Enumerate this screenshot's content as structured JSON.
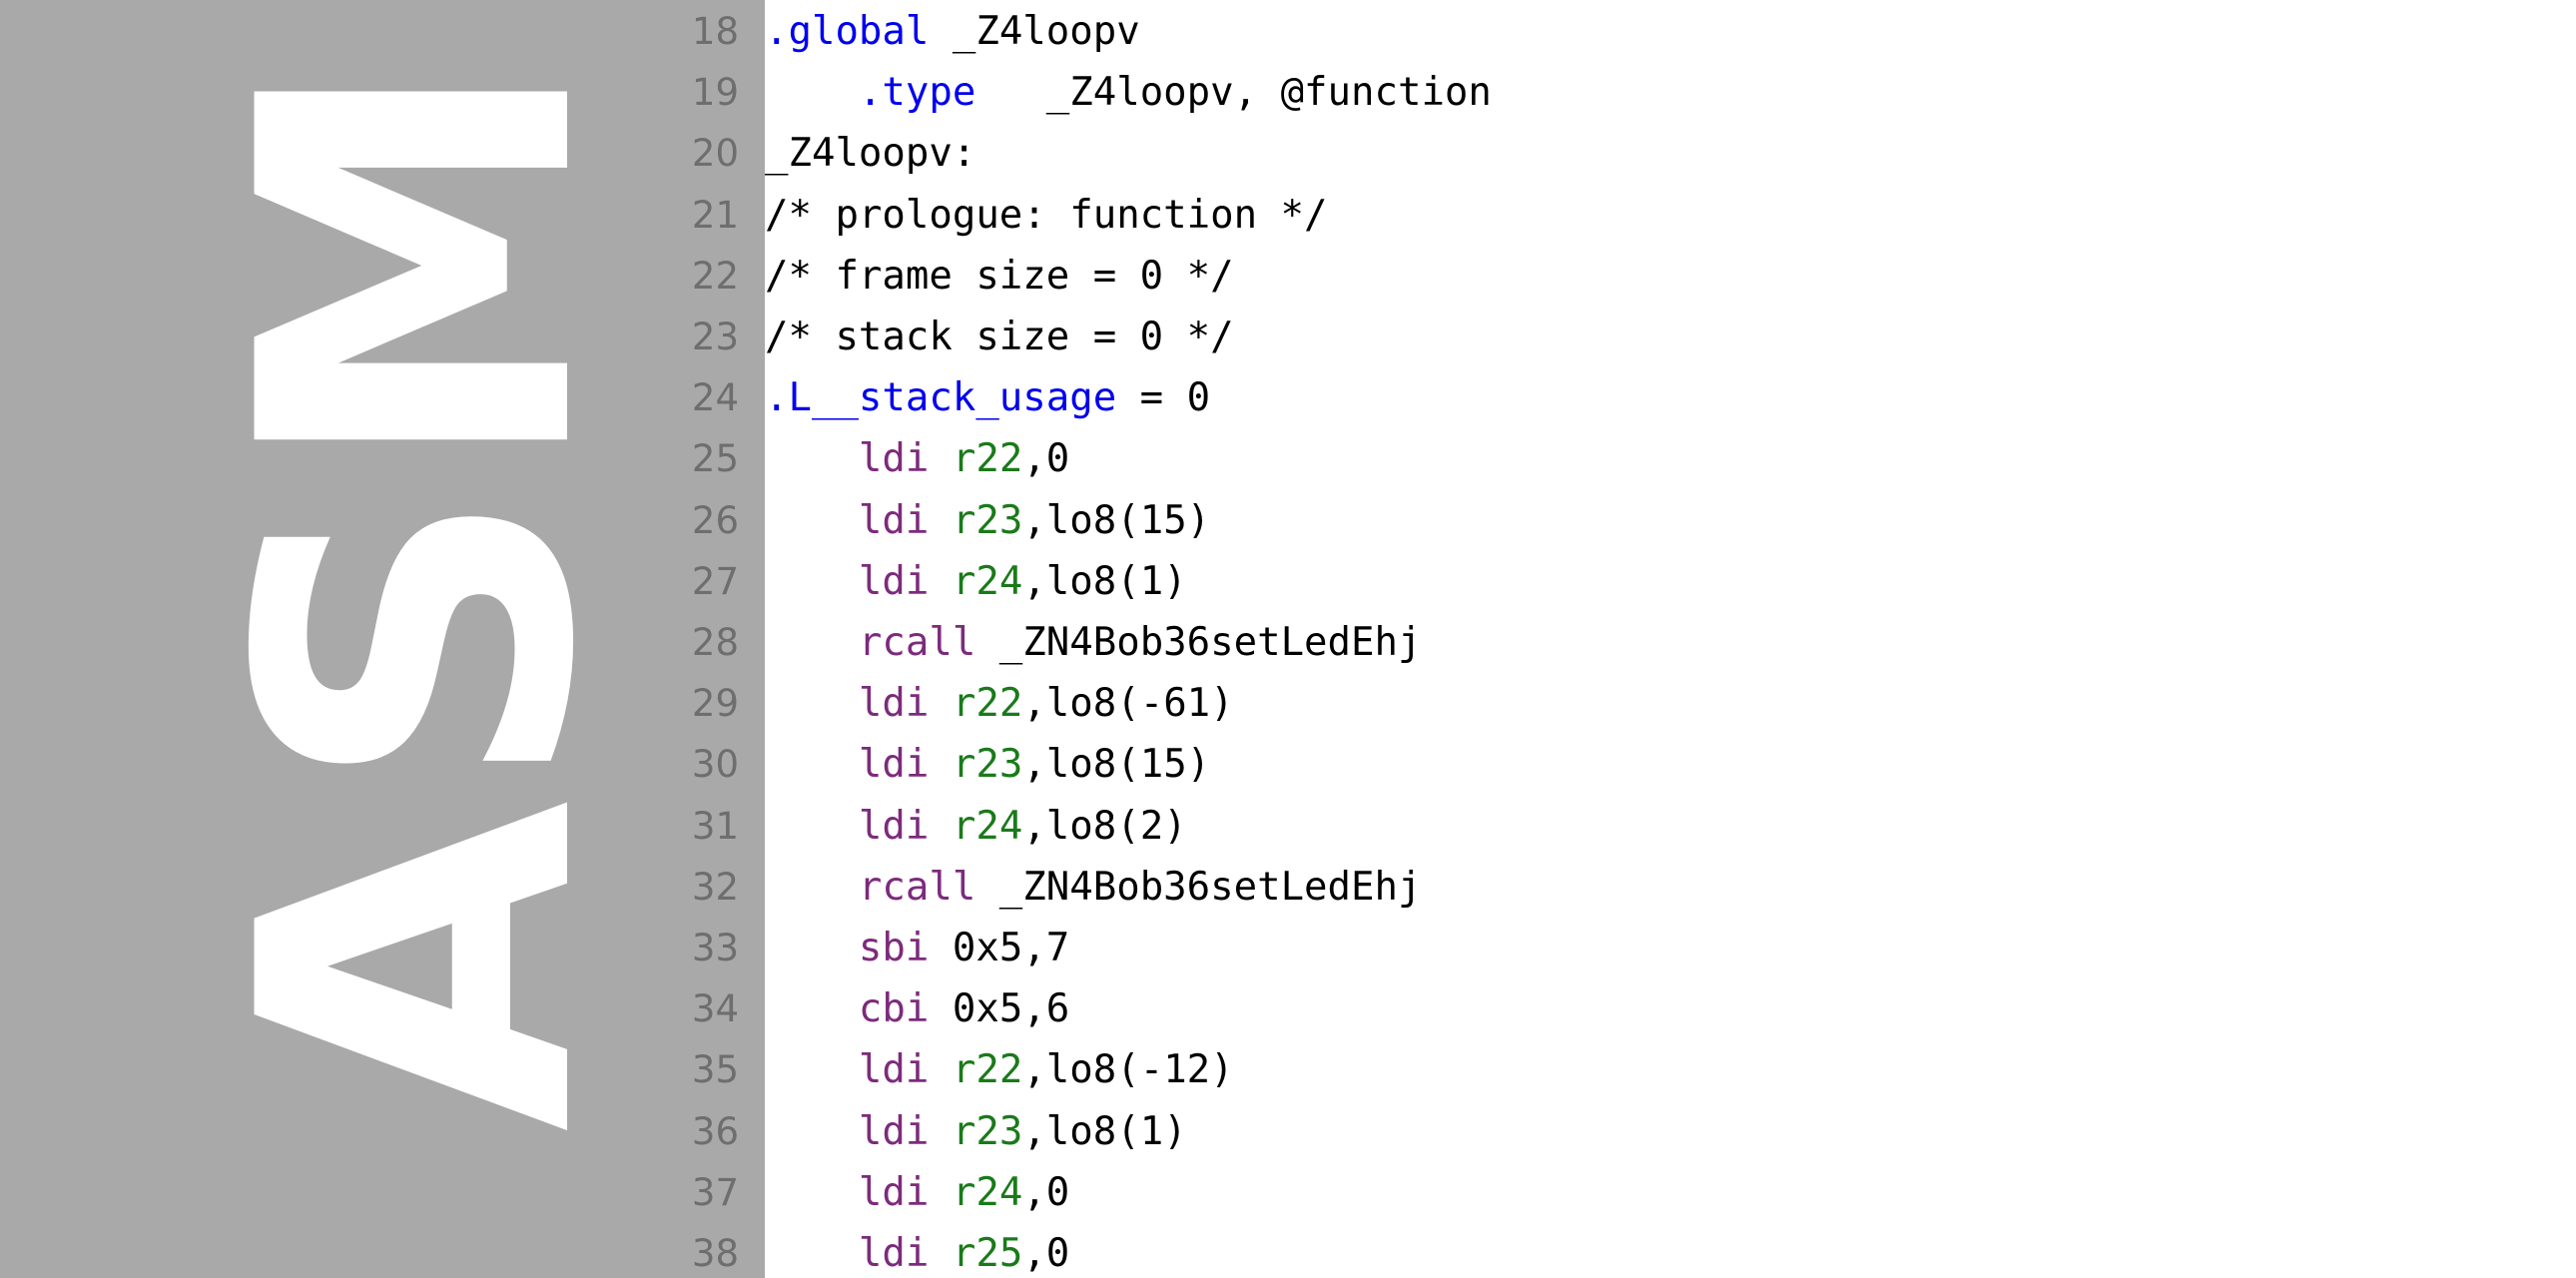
{
  "document": {
    "kind": "assembly-listing",
    "language_label": "ASM",
    "watermark_text": "ASM",
    "first_visible_line": 18,
    "last_visible_line": 38
  },
  "colors": {
    "page_background": "#ffffff",
    "gutter_background": "#a9a9a9",
    "watermark_text": "#ffffff",
    "line_number": "#6e6e6e",
    "directive": "#0000ee",
    "mnemonic": "#7d2a7d",
    "register": "#1a7a1a",
    "plain": "#000000"
  },
  "lines": [
    {
      "number": "18",
      "tokens": [
        {
          "text": ".global",
          "type": "directive"
        },
        {
          "text": " _Z4loopv",
          "type": "plain"
        }
      ]
    },
    {
      "number": "19",
      "tokens": [
        {
          "text": "    ",
          "type": "plain"
        },
        {
          "text": ".type",
          "type": "directive"
        },
        {
          "text": "   _Z4loopv, @function",
          "type": "plain"
        }
      ]
    },
    {
      "number": "20",
      "tokens": [
        {
          "text": "_Z4loopv:",
          "type": "plain"
        }
      ]
    },
    {
      "number": "21",
      "tokens": [
        {
          "text": "/* prologue: function */",
          "type": "comment"
        }
      ]
    },
    {
      "number": "22",
      "tokens": [
        {
          "text": "/* frame size = 0 */",
          "type": "comment"
        }
      ]
    },
    {
      "number": "23",
      "tokens": [
        {
          "text": "/* stack size = 0 */",
          "type": "comment"
        }
      ]
    },
    {
      "number": "24",
      "tokens": [
        {
          "text": ".L__stack_usage",
          "type": "directive"
        },
        {
          "text": " = 0",
          "type": "plain"
        }
      ]
    },
    {
      "number": "25",
      "tokens": [
        {
          "text": "    ",
          "type": "plain"
        },
        {
          "text": "ldi",
          "type": "mnemonic"
        },
        {
          "text": " ",
          "type": "plain"
        },
        {
          "text": "r22",
          "type": "register"
        },
        {
          "text": ",0",
          "type": "plain"
        }
      ]
    },
    {
      "number": "26",
      "tokens": [
        {
          "text": "    ",
          "type": "plain"
        },
        {
          "text": "ldi",
          "type": "mnemonic"
        },
        {
          "text": " ",
          "type": "plain"
        },
        {
          "text": "r23",
          "type": "register"
        },
        {
          "text": ",lo8(15)",
          "type": "plain"
        }
      ]
    },
    {
      "number": "27",
      "tokens": [
        {
          "text": "    ",
          "type": "plain"
        },
        {
          "text": "ldi",
          "type": "mnemonic"
        },
        {
          "text": " ",
          "type": "plain"
        },
        {
          "text": "r24",
          "type": "register"
        },
        {
          "text": ",lo8(1)",
          "type": "plain"
        }
      ]
    },
    {
      "number": "28",
      "tokens": [
        {
          "text": "    ",
          "type": "plain"
        },
        {
          "text": "rcall",
          "type": "mnemonic"
        },
        {
          "text": " _ZN4Bob36setLedEhj",
          "type": "plain"
        }
      ]
    },
    {
      "number": "29",
      "tokens": [
        {
          "text": "    ",
          "type": "plain"
        },
        {
          "text": "ldi",
          "type": "mnemonic"
        },
        {
          "text": " ",
          "type": "plain"
        },
        {
          "text": "r22",
          "type": "register"
        },
        {
          "text": ",lo8(-61)",
          "type": "plain"
        }
      ]
    },
    {
      "number": "30",
      "tokens": [
        {
          "text": "    ",
          "type": "plain"
        },
        {
          "text": "ldi",
          "type": "mnemonic"
        },
        {
          "text": " ",
          "type": "plain"
        },
        {
          "text": "r23",
          "type": "register"
        },
        {
          "text": ",lo8(15)",
          "type": "plain"
        }
      ]
    },
    {
      "number": "31",
      "tokens": [
        {
          "text": "    ",
          "type": "plain"
        },
        {
          "text": "ldi",
          "type": "mnemonic"
        },
        {
          "text": " ",
          "type": "plain"
        },
        {
          "text": "r24",
          "type": "register"
        },
        {
          "text": ",lo8(2)",
          "type": "plain"
        }
      ]
    },
    {
      "number": "32",
      "tokens": [
        {
          "text": "    ",
          "type": "plain"
        },
        {
          "text": "rcall",
          "type": "mnemonic"
        },
        {
          "text": " _ZN4Bob36setLedEhj",
          "type": "plain"
        }
      ]
    },
    {
      "number": "33",
      "tokens": [
        {
          "text": "    ",
          "type": "plain"
        },
        {
          "text": "sbi",
          "type": "mnemonic"
        },
        {
          "text": " 0x5,7",
          "type": "plain"
        }
      ]
    },
    {
      "number": "34",
      "tokens": [
        {
          "text": "    ",
          "type": "plain"
        },
        {
          "text": "cbi",
          "type": "mnemonic"
        },
        {
          "text": " 0x5,6",
          "type": "plain"
        }
      ]
    },
    {
      "number": "35",
      "tokens": [
        {
          "text": "    ",
          "type": "plain"
        },
        {
          "text": "ldi",
          "type": "mnemonic"
        },
        {
          "text": " ",
          "type": "plain"
        },
        {
          "text": "r22",
          "type": "register"
        },
        {
          "text": ",lo8(-12)",
          "type": "plain"
        }
      ]
    },
    {
      "number": "36",
      "tokens": [
        {
          "text": "    ",
          "type": "plain"
        },
        {
          "text": "ldi",
          "type": "mnemonic"
        },
        {
          "text": " ",
          "type": "plain"
        },
        {
          "text": "r23",
          "type": "register"
        },
        {
          "text": ",lo8(1)",
          "type": "plain"
        }
      ]
    },
    {
      "number": "37",
      "tokens": [
        {
          "text": "    ",
          "type": "plain"
        },
        {
          "text": "ldi",
          "type": "mnemonic"
        },
        {
          "text": " ",
          "type": "plain"
        },
        {
          "text": "r24",
          "type": "register"
        },
        {
          "text": ",0",
          "type": "plain"
        }
      ]
    },
    {
      "number": "38",
      "tokens": [
        {
          "text": "    ",
          "type": "plain"
        },
        {
          "text": "ldi",
          "type": "mnemonic"
        },
        {
          "text": " ",
          "type": "plain"
        },
        {
          "text": "r25",
          "type": "register"
        },
        {
          "text": ",0",
          "type": "plain"
        }
      ]
    }
  ]
}
